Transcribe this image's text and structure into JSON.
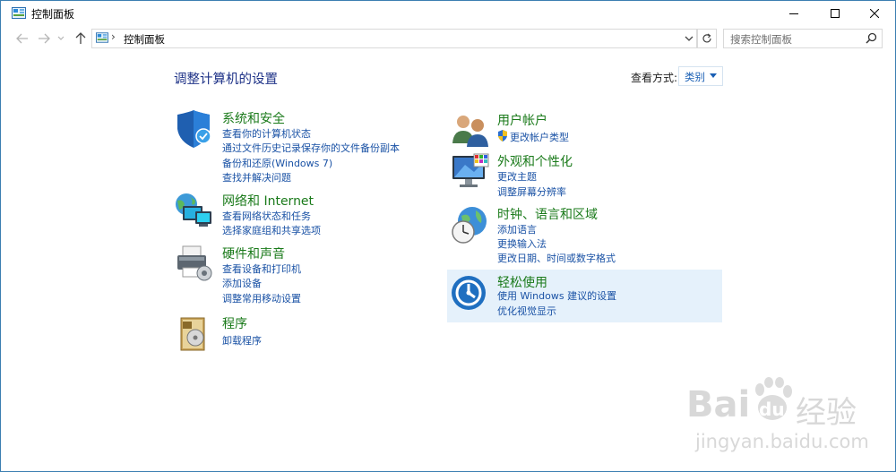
{
  "window": {
    "title": "控制面板"
  },
  "address": {
    "crumb": "控制面板",
    "search_placeholder": "搜索控制面板"
  },
  "content": {
    "heading": "调整计算机的设置",
    "view_by_label": "查看方式:",
    "view_by_value": "类别"
  },
  "categories": {
    "system": {
      "title": "系统和安全",
      "links": [
        "查看你的计算机状态",
        "通过文件历史记录保存你的文件备份副本",
        "备份和还原(Windows 7)",
        "查找并解决问题"
      ]
    },
    "network": {
      "title": "网络和 Internet",
      "links": [
        "查看网络状态和任务",
        "选择家庭组和共享选项"
      ]
    },
    "hardware": {
      "title": "硬件和声音",
      "links": [
        "查看设备和打印机",
        "添加设备",
        "调整常用移动设置"
      ]
    },
    "programs": {
      "title": "程序",
      "links": [
        "卸载程序"
      ]
    },
    "users": {
      "title": "用户帐户",
      "links": [
        "更改帐户类型"
      ]
    },
    "appearance": {
      "title": "外观和个性化",
      "links": [
        "更改主题",
        "调整屏幕分辨率"
      ]
    },
    "clock": {
      "title": "时钟、语言和区域",
      "links": [
        "添加语言",
        "更换输入法",
        "更改日期、时间或数字格式"
      ]
    },
    "ease": {
      "title": "轻松使用",
      "links": [
        "使用 Windows 建议的设置",
        "优化视觉显示"
      ]
    }
  },
  "watermark": {
    "brand": "Bai",
    "brand2": "du",
    "brand_cn": "经验",
    "url": "jingyan.baidu.com"
  },
  "colors": {
    "category_title": "#1a7a1a",
    "link": "#1a52a5",
    "heading": "#1e3287",
    "highlight": "#e5f1fb"
  }
}
